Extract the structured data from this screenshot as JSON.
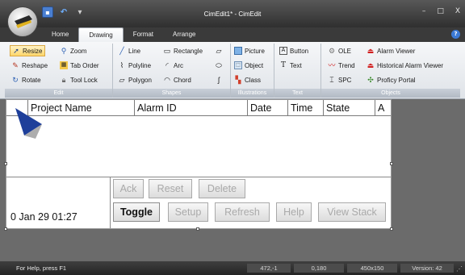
{
  "window": {
    "title": "CimEdit1* - CimEdit",
    "minimize_icon": "minimize-icon",
    "maximize_icon": "maximize-icon",
    "close_icon": "close-icon",
    "min_label": "–",
    "max_label": "□",
    "close_label": "X"
  },
  "quick_access": {
    "save_glyph": "▪",
    "undo_glyph": "↶",
    "more_glyph": "▾"
  },
  "tabs": [
    {
      "label": "Home",
      "active": false
    },
    {
      "label": "Drawing",
      "active": true
    },
    {
      "label": "Format",
      "active": false
    },
    {
      "label": "Arrange",
      "active": false
    }
  ],
  "help_label": "?",
  "ribbon": {
    "edit": {
      "label": "Edit",
      "buttons": [
        "Resize",
        "Zoom",
        "Reshape",
        "Tab Order",
        "Rotate",
        "Tool Lock"
      ]
    },
    "shapes": {
      "label": "Shapes",
      "buttons": [
        "Line",
        "Rectangle",
        "Polyline",
        "Arc",
        "Polygon",
        "Chord"
      ]
    },
    "illustrations": {
      "label": "Illustrations",
      "buttons": [
        "Picture",
        "Object",
        "Class"
      ]
    },
    "text": {
      "label": "Text",
      "buttons": [
        "Button",
        "Text"
      ]
    },
    "objects": {
      "label": "Objects",
      "buttons": [
        "OLE",
        "Alarm Viewer",
        "Trend",
        "Historical Alarm Viewer",
        "SPC",
        "Proficy Portal"
      ]
    }
  },
  "alarm_grid": {
    "columns": [
      "Project Name",
      "Alarm ID",
      "Date",
      "Time",
      "State",
      "A"
    ],
    "datetime": "0 Jan 29 01:27"
  },
  "controls": {
    "ack": "Ack",
    "reset": "Reset",
    "delete": "Delete",
    "toggle": "Toggle",
    "setup": "Setup",
    "refresh": "Refresh",
    "help": "Help",
    "view_stack": "View Stack"
  },
  "status": {
    "message": "For Help, press F1",
    "cells": [
      "472,-1",
      "0,180",
      "450x150",
      "Version: 42"
    ]
  },
  "colors": {
    "selected_accent": "#ffd76b",
    "chrome_dark": "#2f2f2f",
    "canvas_bg": "#6b6b6b"
  }
}
